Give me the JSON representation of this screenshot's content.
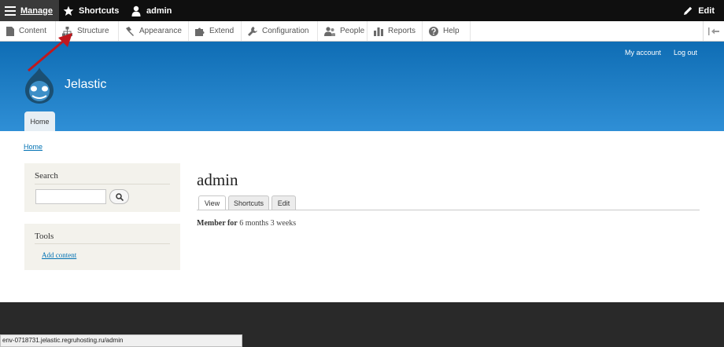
{
  "toolbar": {
    "manage_label": "Manage",
    "shortcuts_label": "Shortcuts",
    "user_label": "admin",
    "edit_label": "Edit"
  },
  "admin_menu": {
    "items": [
      {
        "label": "Content",
        "icon": "file-icon"
      },
      {
        "label": "Structure",
        "icon": "sitemap-icon"
      },
      {
        "label": "Appearance",
        "icon": "paint-icon"
      },
      {
        "label": "Extend",
        "icon": "puzzle-icon"
      },
      {
        "label": "Configuration",
        "icon": "wrench-icon"
      },
      {
        "label": "People",
        "icon": "people-icon"
      },
      {
        "label": "Reports",
        "icon": "chart-icon"
      },
      {
        "label": "Help",
        "icon": "help-icon"
      }
    ]
  },
  "header": {
    "site_name": "Jelastic",
    "my_account_label": "My account",
    "logout_label": "Log out",
    "home_tab_label": "Home"
  },
  "breadcrumb": {
    "home_label": "Home"
  },
  "sidebar": {
    "search_title": "Search",
    "tools_title": "Tools",
    "add_content_label": "Add content"
  },
  "main": {
    "title": "admin",
    "tabs": [
      {
        "label": "View",
        "active": true
      },
      {
        "label": "Shortcuts",
        "active": false
      },
      {
        "label": "Edit",
        "active": false
      }
    ],
    "member_for_label": "Member for",
    "member_for_value": "6 months 3 weeks"
  },
  "status_url": "env-0718731.jelastic.regruhosting.ru/admin",
  "colors": {
    "header_blue": "#0f6db4",
    "link_blue": "#0071b3",
    "toolbar_black": "#0f0f0f",
    "annotation_red": "#c0181e"
  }
}
